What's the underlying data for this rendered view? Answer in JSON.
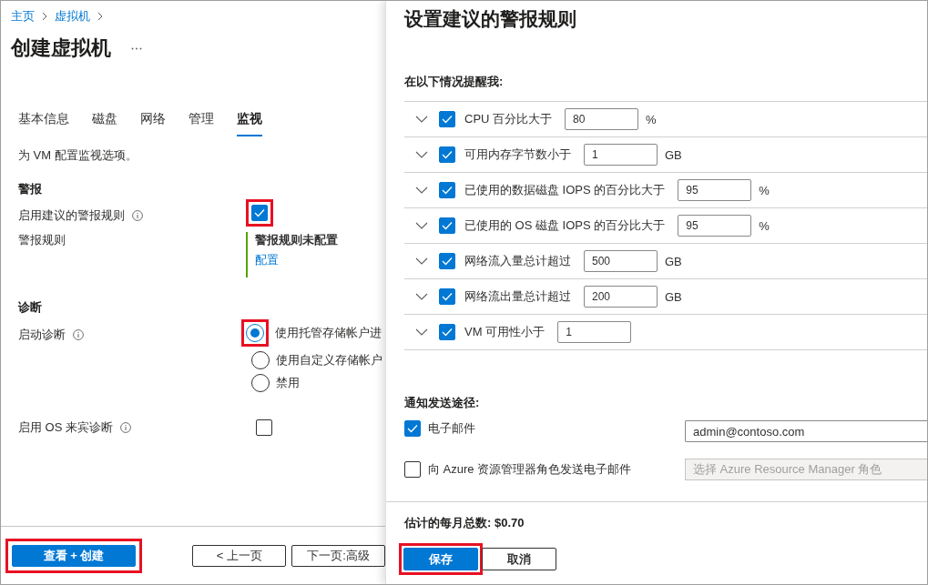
{
  "breadcrumb": [
    {
      "label": "主页"
    },
    {
      "label": "虚拟机"
    }
  ],
  "page_title": "创建虚拟机",
  "tabs": [
    {
      "label": "基本信息",
      "selected": false
    },
    {
      "label": "磁盘",
      "selected": false
    },
    {
      "label": "网络",
      "selected": false
    },
    {
      "label": "管理",
      "selected": false
    },
    {
      "label": "监视",
      "selected": true
    }
  ],
  "description": "为 VM 配置监视选项。",
  "alerts": {
    "heading": "警报",
    "enable_recommended": {
      "label": "启用建议的警报规则",
      "checked": true,
      "highlighted": true
    },
    "rules": {
      "label": "警报规则",
      "status": "警报规则未配置",
      "link": "配置"
    }
  },
  "diagnostics": {
    "heading": "诊断",
    "boot": {
      "label": "启动诊断",
      "options": [
        {
          "label": "使用托管存储帐户进",
          "selected": true,
          "highlighted": true
        },
        {
          "label": "使用自定义存储帐户",
          "selected": false,
          "highlighted": false
        },
        {
          "label": "禁用",
          "selected": false,
          "highlighted": false
        }
      ]
    },
    "guest_os": {
      "label": "启用 OS 来宾诊断",
      "checked": false
    }
  },
  "footer_buttons": [
    {
      "label": "查看 + 创建",
      "kind": "primary",
      "highlighted": true
    },
    {
      "label": "< 上一页",
      "kind": "secondary",
      "highlighted": false
    },
    {
      "label": "下一页:高级",
      "kind": "secondary",
      "highlighted": false
    }
  ],
  "panel": {
    "title": "设置建议的警报规则",
    "conditions_heading": "在以下情况提醒我:",
    "conditions": [
      {
        "label": "CPU 百分比大于",
        "checked": true,
        "value": "80",
        "unit": "%"
      },
      {
        "label": "可用内存字节数小于",
        "checked": true,
        "value": "1",
        "unit": "GB"
      },
      {
        "label": "已使用的数据磁盘 IOPS 的百分比大于",
        "checked": true,
        "value": "95",
        "unit": "%"
      },
      {
        "label": "已使用的 OS 磁盘 IOPS 的百分比大于",
        "checked": true,
        "value": "95",
        "unit": "%"
      },
      {
        "label": "网络流入量总计超过",
        "checked": true,
        "value": "500",
        "unit": "GB"
      },
      {
        "label": "网络流出量总计超过",
        "checked": true,
        "value": "200",
        "unit": "GB"
      },
      {
        "label": "VM 可用性小于",
        "checked": true,
        "value": "1"
      }
    ],
    "notify_heading": "通知发送途径:",
    "notify": [
      {
        "label": "电子邮件",
        "checked": true,
        "kind": "text",
        "value": "admin@contoso.com"
      },
      {
        "label": "向 Azure 资源管理器角色发送电子邮件",
        "checked": false,
        "kind": "select",
        "placeholder": "选择 Azure Resource Manager 角色"
      }
    ],
    "estimate": "估计的每月总数: $0.70",
    "buttons": [
      {
        "label": "保存",
        "kind": "primary",
        "highlighted": true
      },
      {
        "label": "取消",
        "kind": "secondary",
        "highlighted": false
      }
    ]
  }
}
